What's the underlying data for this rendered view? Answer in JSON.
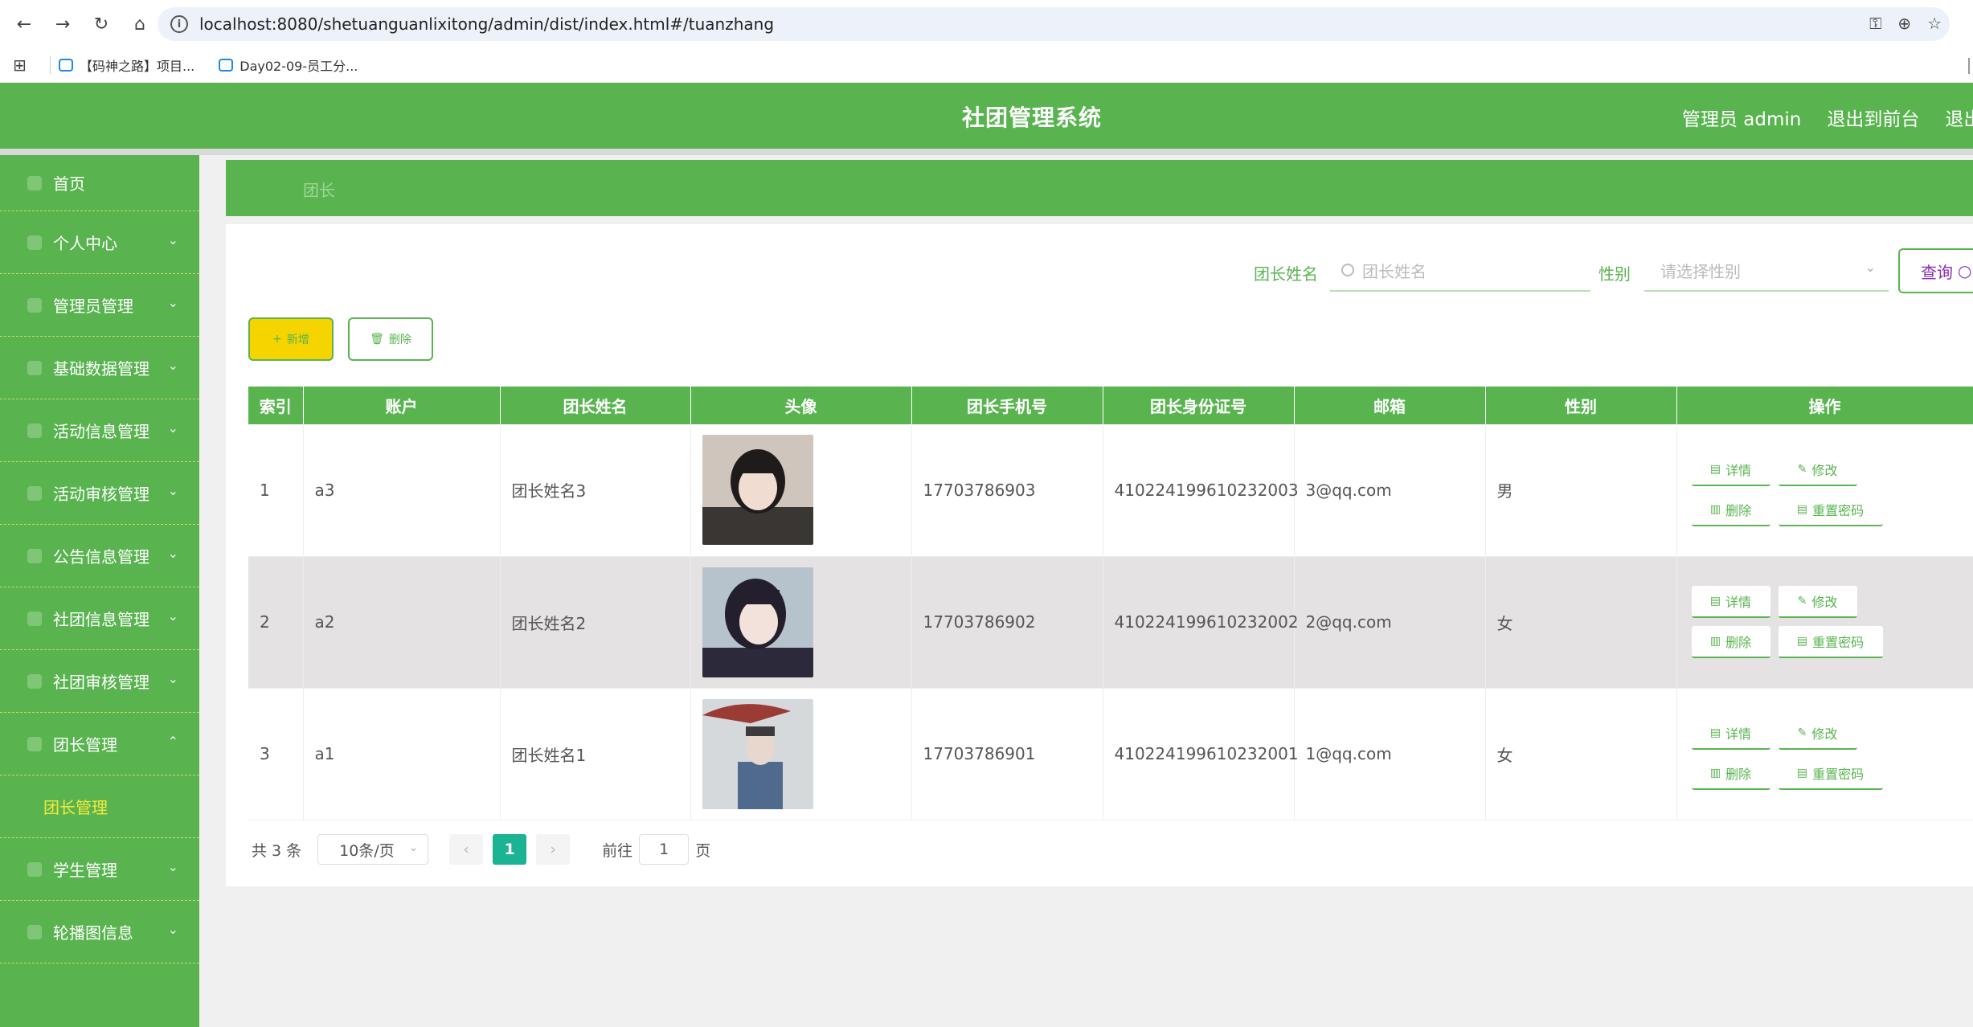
{
  "browser": {
    "url": "localhost:8080/shetuanguanlixitong/admin/dist/index.html#/tuanzhang",
    "bookmarks": [
      "【码神之路】项目...",
      "Day02-09-员工分..."
    ]
  },
  "header": {
    "title": "社团管理系统",
    "links": [
      "管理员 admin",
      "退出到前台",
      "退出登录"
    ]
  },
  "sidebar": {
    "items": [
      {
        "label": "首页"
      },
      {
        "label": "个人中心"
      },
      {
        "label": "管理员管理"
      },
      {
        "label": "基础数据管理"
      },
      {
        "label": "活动信息管理"
      },
      {
        "label": "活动审核管理"
      },
      {
        "label": "公告信息管理"
      },
      {
        "label": "社团信息管理"
      },
      {
        "label": "社团审核管理"
      },
      {
        "label": "团长管理"
      },
      {
        "label": "学生管理"
      },
      {
        "label": "轮播图信息"
      }
    ],
    "active_sub": "团长管理"
  },
  "breadcrumb": "团长",
  "search": {
    "name_label": "团长姓名",
    "name_placeholder": "团长姓名",
    "gender_label": "性别",
    "gender_placeholder": "请选择性别",
    "query_label": "查询"
  },
  "actions": {
    "add": "新增",
    "delete": "删除"
  },
  "table": {
    "columns": [
      "索引",
      "账户",
      "团长姓名",
      "头像",
      "团长手机号",
      "团长身份证号",
      "邮箱",
      "性别",
      "操作"
    ],
    "rows": [
      {
        "index": "1",
        "account": "a3",
        "name": "团长姓名3",
        "phone": "17703786903",
        "id_card": "410224199610232003",
        "email": "3@qq.com",
        "gender": "男"
      },
      {
        "index": "2",
        "account": "a2",
        "name": "团长姓名2",
        "phone": "17703786902",
        "id_card": "410224199610232002",
        "email": "2@qq.com",
        "gender": "女"
      },
      {
        "index": "3",
        "account": "a1",
        "name": "团长姓名1",
        "phone": "17703786901",
        "id_card": "410224199610232001",
        "email": "1@qq.com",
        "gender": "女"
      }
    ],
    "ops": {
      "detail": "详情",
      "edit": "修改",
      "delete": "删除",
      "reset": "重置密码"
    }
  },
  "pager": {
    "total": "共 3 条",
    "page_size": "10条/页",
    "current": "1",
    "goto_prefix": "前往",
    "goto_value": "1",
    "goto_suffix": "页"
  }
}
